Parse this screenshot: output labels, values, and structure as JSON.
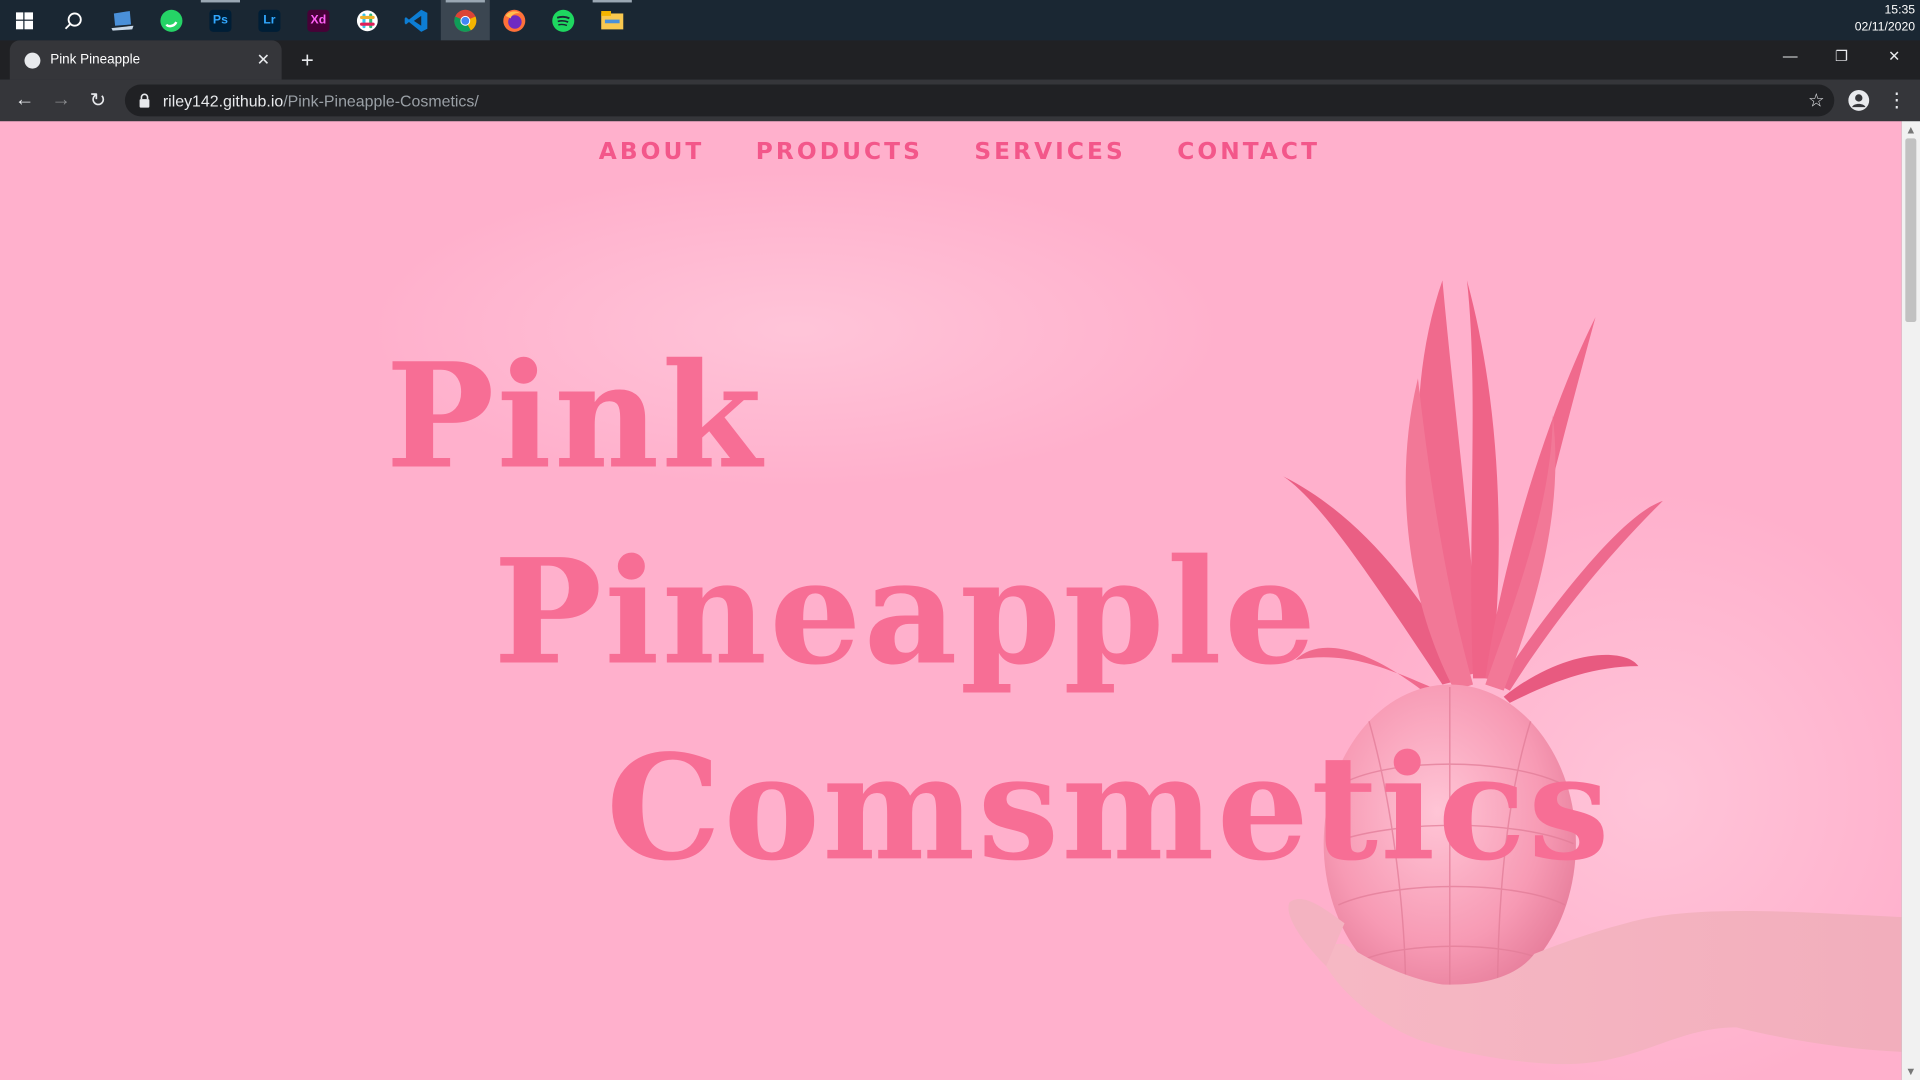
{
  "taskbar": {
    "apps": [
      {
        "name": "windows-start-icon",
        "label": ""
      },
      {
        "name": "search-icon",
        "label": ""
      },
      {
        "name": "file-transfer-app-icon",
        "label": ""
      },
      {
        "name": "whatsapp-icon",
        "label": ""
      },
      {
        "name": "photoshop-icon",
        "label": "Ps"
      },
      {
        "name": "lightroom-icon",
        "label": "Lr"
      },
      {
        "name": "xd-icon",
        "label": "Xd"
      },
      {
        "name": "slack-icon",
        "label": ""
      },
      {
        "name": "vscode-icon",
        "label": ""
      },
      {
        "name": "chrome-icon",
        "label": ""
      },
      {
        "name": "firefox-icon",
        "label": ""
      },
      {
        "name": "spotify-icon",
        "label": ""
      },
      {
        "name": "file-explorer-icon",
        "label": ""
      }
    ],
    "time": "15:35",
    "date": "02/11/2020"
  },
  "browser": {
    "tab_title": "Pink Pineapple",
    "tab_close": "✕",
    "new_tab": "+",
    "url_host": "riley142.github.io",
    "url_path": "/Pink-Pineapple-Cosmetics/",
    "window_controls": {
      "minimize": "—",
      "restore": "❐",
      "close": "✕"
    }
  },
  "page": {
    "nav": [
      "ABOUT",
      "PRODUCTS",
      "SERVICES",
      "CONTACT"
    ],
    "hero": [
      "Pink",
      "Pineapple",
      "Comsmetics"
    ]
  },
  "colors": {
    "background": "#ffb0cc",
    "accent": "#f76e95",
    "nav_text": "#f3578a"
  }
}
